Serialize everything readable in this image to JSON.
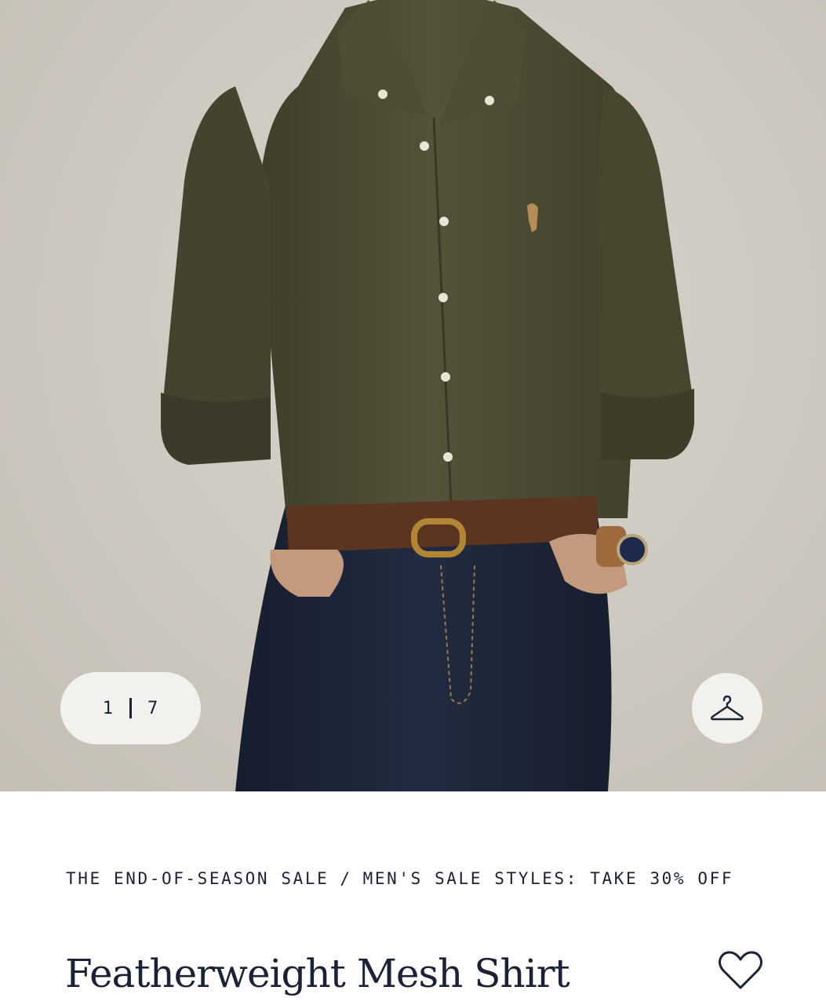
{
  "gallery": {
    "current_index": "1",
    "total_count": "7",
    "hanger_icon": "hanger-icon"
  },
  "breadcrumb": {
    "items": [
      "THE END-OF-SEASON SALE",
      "MEN'S SALE STYLES: TAKE 30% OFF"
    ],
    "separator": "/"
  },
  "product": {
    "title": "Featherweight Mesh Shirt",
    "wishlist_icon": "heart-icon"
  },
  "colors": {
    "text": "#1a2236",
    "pill_background": "#f3f1ee",
    "shirt": "#4b4a33",
    "denim": "#1c2436",
    "belt": "#5b3520"
  }
}
